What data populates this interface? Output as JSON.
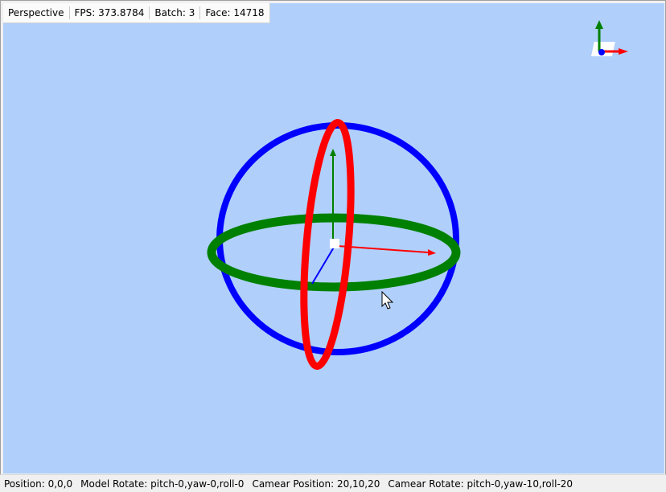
{
  "toolbar": {
    "projection_label": "Perspective",
    "fps_label": "FPS: 373.8784",
    "batch_label": "Batch: 3",
    "face_label": "Face: 14718"
  },
  "viewport": {
    "background_color": "#b0d0fb",
    "gizmo": {
      "x_ring_color": "#ff0000",
      "y_ring_color": "#008000",
      "z_ring_color": "#0000ff"
    },
    "axis_indicator": {
      "x_color": "#ff0000",
      "y_color": "#008000",
      "z_color": "#0000ff"
    },
    "cursor_icon": "arrow-cursor"
  },
  "statusbar": {
    "position": "Position: 0,0,0",
    "model_rotate": "Model Rotate: pitch-0,yaw-0,roll-0",
    "camera_position": "Camear Position: 20,10,20",
    "camera_rotate": "Camear Rotate: pitch-0,yaw-10,roll-20"
  }
}
